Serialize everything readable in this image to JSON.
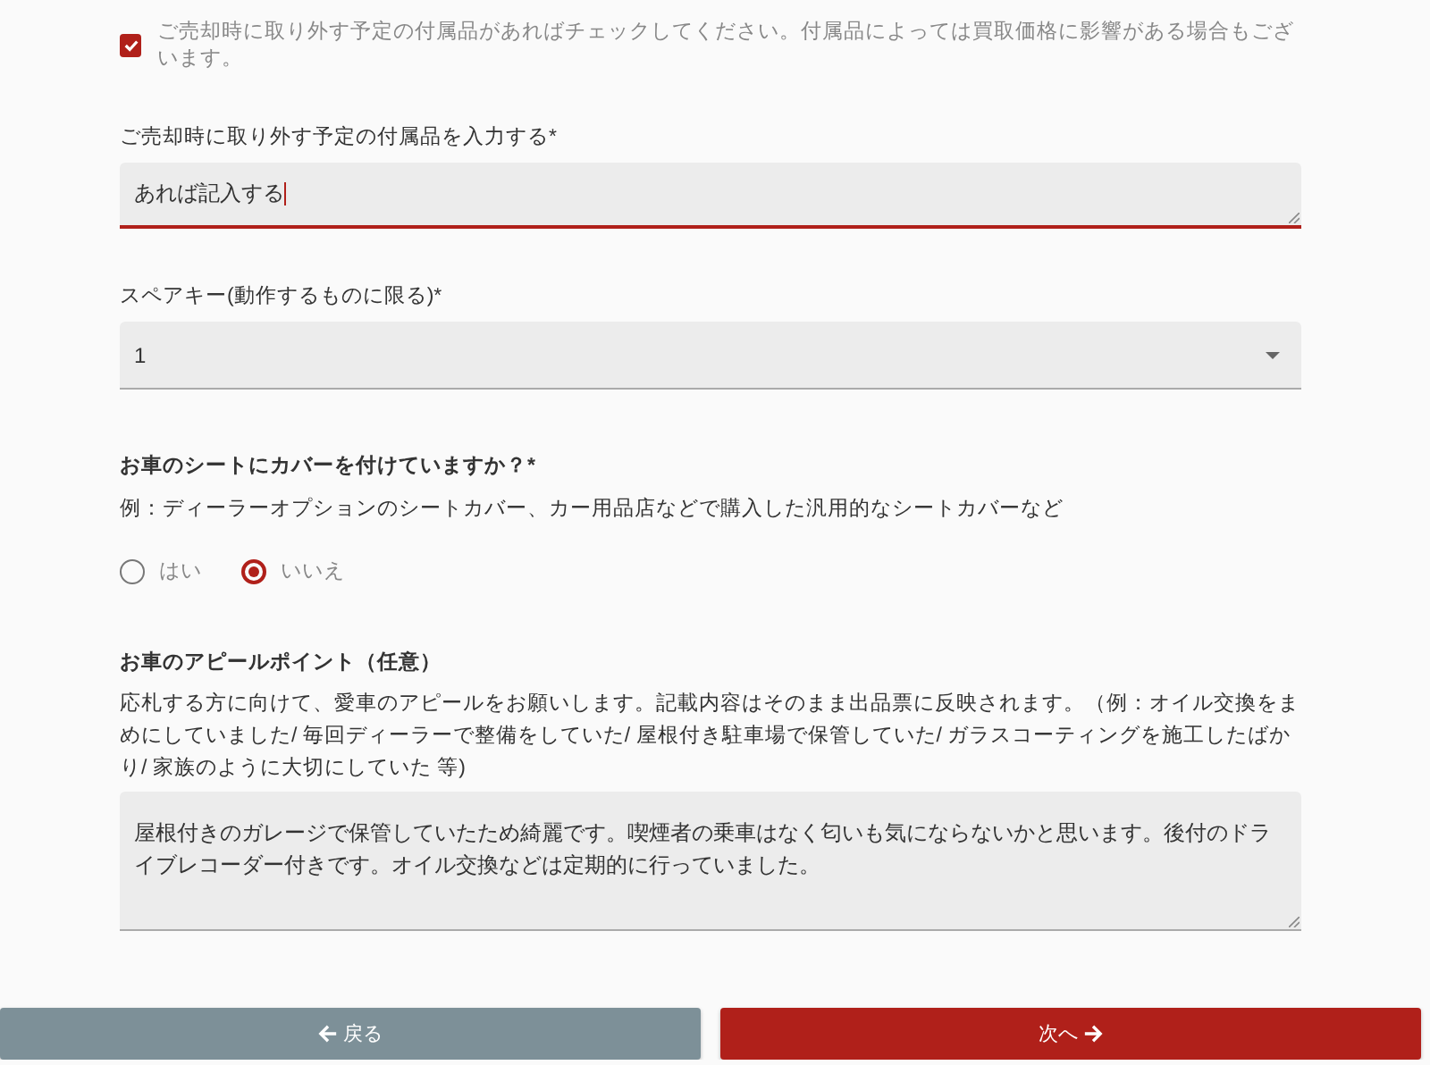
{
  "accessory_check": {
    "label": "ご売却時に取り外す予定の付属品があればチェックしてください。付属品によっては買取価格に影響がある場合もございます。",
    "checked": true
  },
  "accessory_field": {
    "label": "ご売却時に取り外す予定の付属品を入力する*",
    "value": "あれば記入する",
    "focused": true
  },
  "spare_key": {
    "label": "スペアキー(動作するものに限る)*",
    "value": "1"
  },
  "seat_cover": {
    "label": "お車のシートにカバーを付けていますか？*",
    "hint": "例：ディーラーオプションのシートカバー、カー用品店などで購入した汎用的なシートカバーなど",
    "options": [
      {
        "label": "はい",
        "selected": false
      },
      {
        "label": "いいえ",
        "selected": true
      }
    ]
  },
  "appeal": {
    "label": "お車のアピールポイント（任意）",
    "description": "応札する方に向けて、愛車のアピールをお願いします。記載内容はそのまま出品票に反映されます。（例：オイル交換をまめにしていました/ 毎回ディーラーで整備をしていた/ 屋根付き駐車場で保管していた/ ガラスコーティングを施工したばかり/ 家族のように大切にしていた 等)",
    "value": "屋根付きのガレージで保管していたため綺麗です。喫煙者の乗車はなく匂いも気にならないかと思います。後付のドライブレコーダー付きです。オイル交換などは定期的に行っていました。"
  },
  "buttons": [
    {
      "label": "戻る",
      "kind": "back"
    },
    {
      "label": "次へ",
      "kind": "next"
    }
  ]
}
